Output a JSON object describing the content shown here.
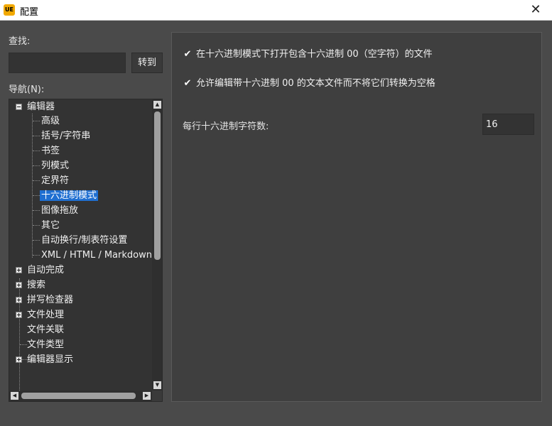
{
  "window": {
    "app_icon_text": "UE",
    "title": "配置",
    "close_glyph": "✕"
  },
  "search": {
    "label": "查找:",
    "value": "",
    "goto_label": "转到"
  },
  "nav": {
    "label": "导航(N):",
    "tree": [
      {
        "label": "编辑器",
        "expander": "minus",
        "level": 0
      },
      {
        "label": "高级",
        "level": 1
      },
      {
        "label": "括号/字符串",
        "level": 1
      },
      {
        "label": "书签",
        "level": 1
      },
      {
        "label": "列模式",
        "level": 1
      },
      {
        "label": "定界符",
        "level": 1
      },
      {
        "label": "十六进制模式",
        "level": 1,
        "selected": true
      },
      {
        "label": "图像拖放",
        "level": 1
      },
      {
        "label": "其它",
        "level": 1
      },
      {
        "label": "自动换行/制表符设置",
        "level": 1
      },
      {
        "label": "XML / HTML / Markdown",
        "level": 1
      },
      {
        "label": "自动完成",
        "expander": "plus",
        "level": 0
      },
      {
        "label": "搜索",
        "expander": "plus",
        "level": 0
      },
      {
        "label": "拼写检查器",
        "expander": "plus",
        "level": 0
      },
      {
        "label": "文件处理",
        "expander": "plus",
        "level": 0
      },
      {
        "label": "文件关联",
        "level": 0
      },
      {
        "label": "文件类型",
        "level": 0
      },
      {
        "label": "编辑器显示",
        "expander": "plus",
        "level": 0
      }
    ]
  },
  "hex_settings": {
    "option1": {
      "label": "在十六进制模式下打开包含十六进制 00（空字符）的文件",
      "checked": true
    },
    "option2": {
      "label": "允许编辑带十六进制 00 的文本文件而不将它们转换为空格",
      "checked": true
    },
    "chars_per_line_label": "每行十六进制字符数:",
    "chars_per_line_value": "16"
  },
  "colors": {
    "background": "#4a4a4a",
    "panel": "#3f3f3f",
    "input": "#333333",
    "selection": "#1f6fd1",
    "app_icon": "#f2a900"
  }
}
